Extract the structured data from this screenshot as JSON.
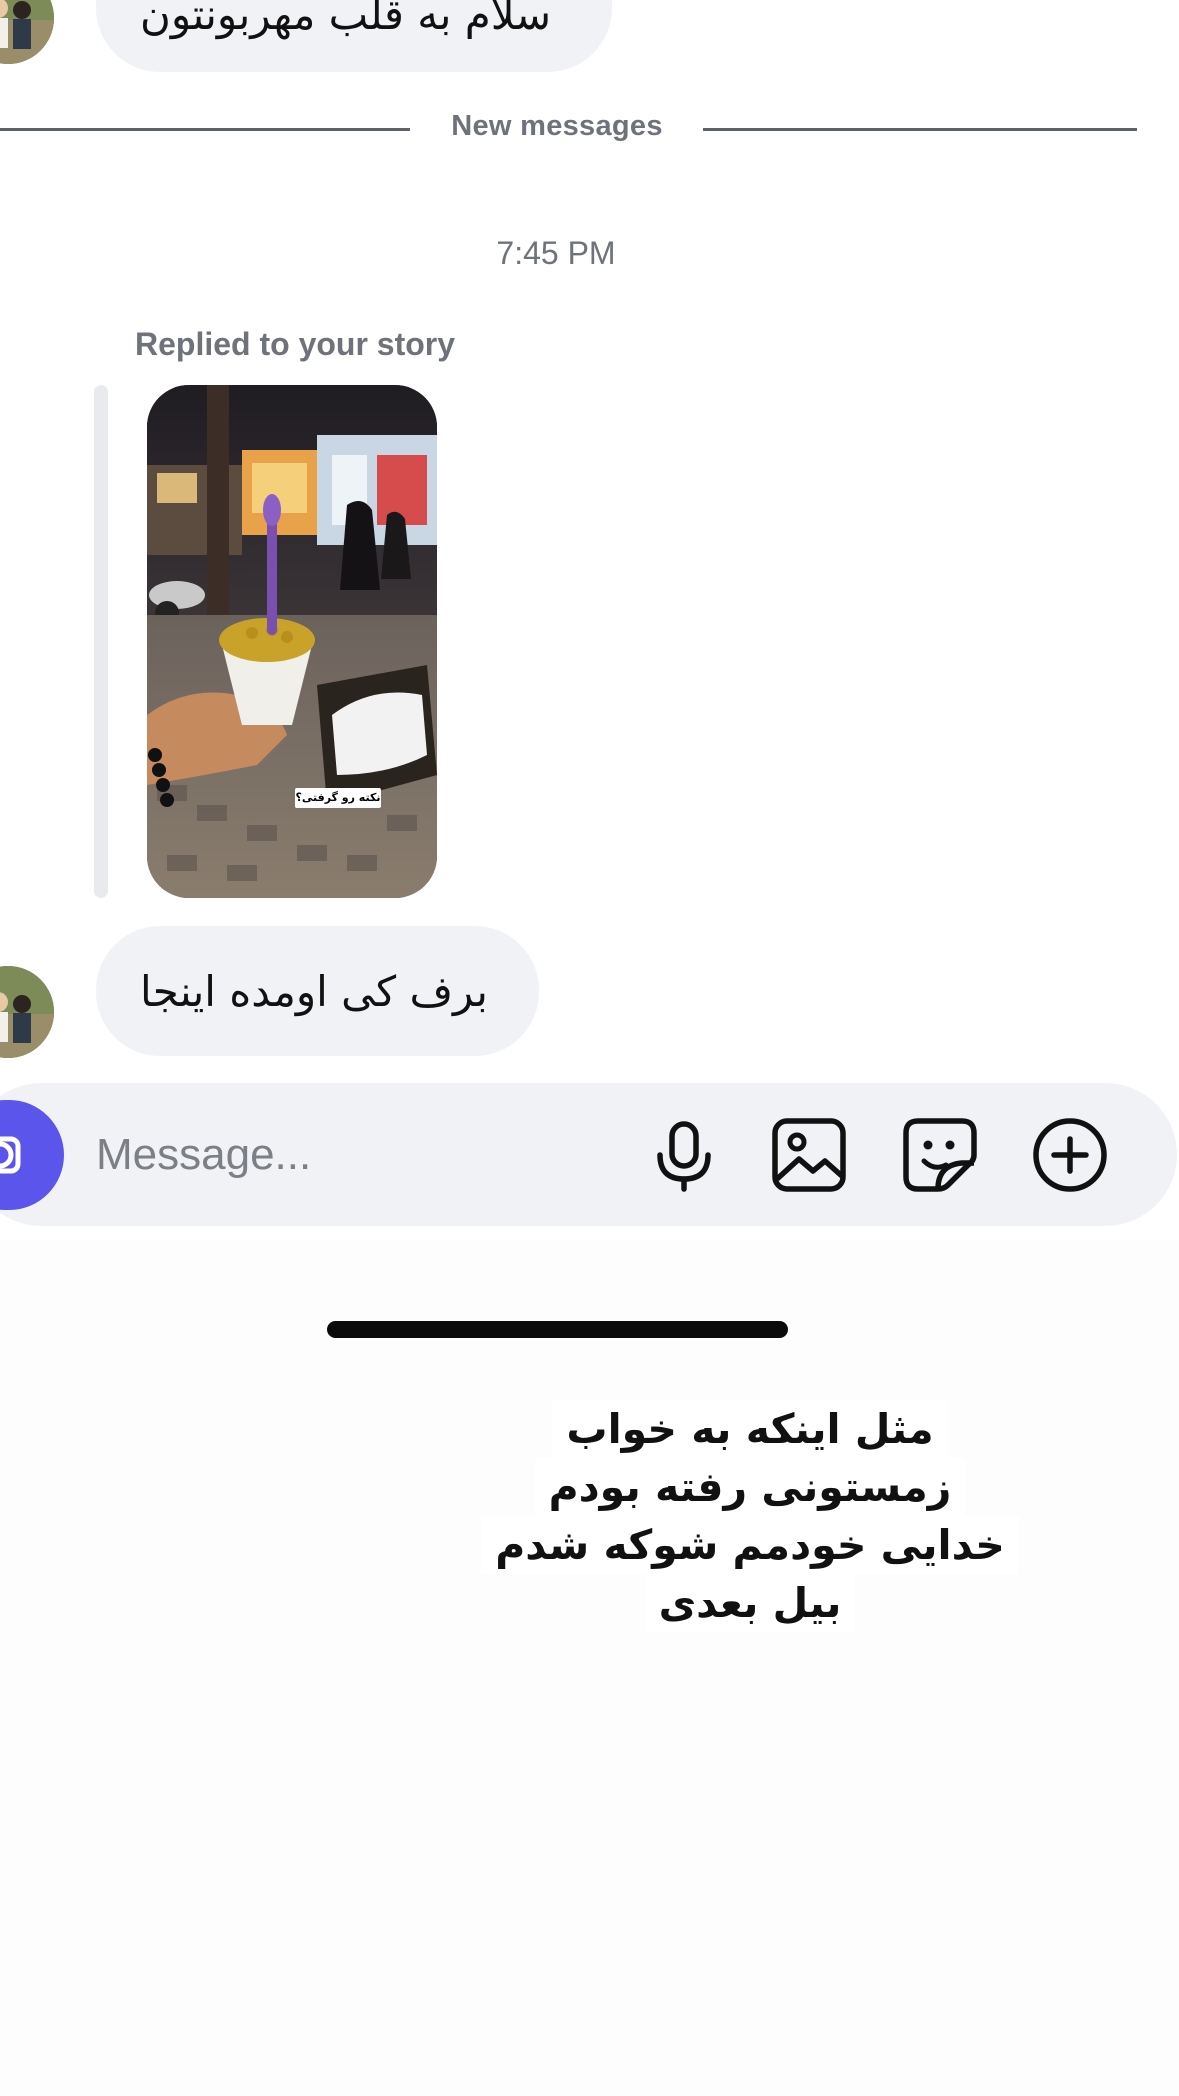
{
  "conversation": {
    "previous_message": "سلام به قلب مهربونتون",
    "divider_label": "New messages",
    "timestamp": "7:45 PM",
    "reply_label": "Replied to your story",
    "story_caption": "نکته رو گرفتی؟",
    "latest_message": "برف کی اومده اینجا"
  },
  "composer": {
    "placeholder": "Message...",
    "icons": [
      "camera-icon",
      "microphone-icon",
      "gallery-icon",
      "sticker-icon",
      "add-icon"
    ]
  },
  "overlay_caption": {
    "lines": [
      "مثل اینکه به خواب",
      "زمستونی رفته بودم",
      "خدایی خودمم شوکه شدم",
      "بیل بعدی"
    ]
  },
  "colors": {
    "accent": "#5b55ec",
    "bubble": "#f1f2f5",
    "muted_text": "#6e727a",
    "text": "#0a0a0a"
  }
}
